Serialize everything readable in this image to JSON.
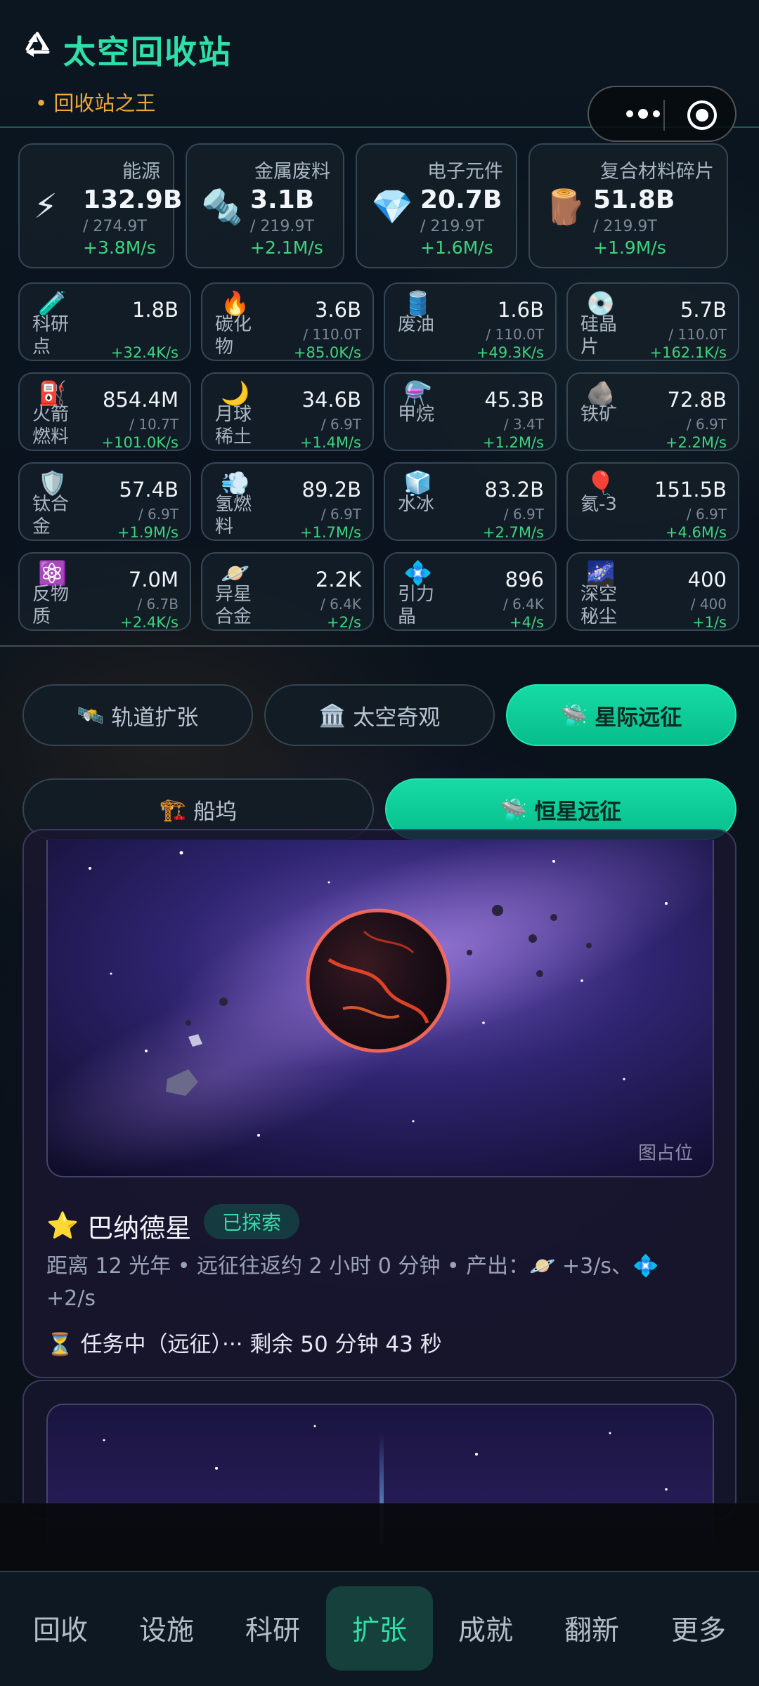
{
  "header": {
    "title": "太空回收站",
    "subtitle": "• 回收站之王",
    "logo_icon": "recycle-icon",
    "menu_icon": "more-dots-icon",
    "target_icon": "record-target-icon"
  },
  "primary_resources": [
    {
      "icon": "⚡",
      "name": "能源",
      "value": "132.9B",
      "capacity": "/ 274.9T",
      "rate": "+3.8M/s"
    },
    {
      "icon": "🔩",
      "name": "金属废料",
      "value": "3.1B",
      "capacity": "/ 219.9T",
      "rate": "+2.1M/s"
    },
    {
      "icon": "💎",
      "name": "电子元件",
      "value": "20.7B",
      "capacity": "/ 219.9T",
      "rate": "+1.6M/s"
    },
    {
      "icon": "🪵",
      "name": "复合材料碎片",
      "value": "51.8B",
      "capacity": "/ 219.9T",
      "rate": "+1.9M/s"
    }
  ],
  "secondary_resources": [
    {
      "icon": "🧪",
      "name": "科研点",
      "value": "1.8B",
      "capacity": "",
      "rate": "+32.4K/s"
    },
    {
      "icon": "🔥",
      "name": "碳化物",
      "value": "3.6B",
      "capacity": "/ 110.0T",
      "rate": "+85.0K/s"
    },
    {
      "icon": "🛢️",
      "name": "废油",
      "value": "1.6B",
      "capacity": "/ 110.0T",
      "rate": "+49.3K/s"
    },
    {
      "icon": "💿",
      "name": "硅晶片",
      "value": "5.7B",
      "capacity": "/ 110.0T",
      "rate": "+162.1K/s"
    },
    {
      "icon": "⛽",
      "name": "火箭燃料",
      "value": "854.4M",
      "capacity": "/ 10.7T",
      "rate": "+101.0K/s"
    },
    {
      "icon": "🌙",
      "name": "月球稀土",
      "value": "34.6B",
      "capacity": "/ 6.9T",
      "rate": "+1.4M/s"
    },
    {
      "icon": "⚗️",
      "name": "甲烷",
      "value": "45.3B",
      "capacity": "/ 3.4T",
      "rate": "+1.2M/s"
    },
    {
      "icon": "🪨",
      "name": "铁矿",
      "value": "72.8B",
      "capacity": "/ 6.9T",
      "rate": "+2.2M/s"
    },
    {
      "icon": "🛡️",
      "name": "钛合金",
      "value": "57.4B",
      "capacity": "/ 6.9T",
      "rate": "+1.9M/s"
    },
    {
      "icon": "💨",
      "name": "氢燃料",
      "value": "89.2B",
      "capacity": "/ 6.9T",
      "rate": "+1.7M/s"
    },
    {
      "icon": "🧊",
      "name": "水冰",
      "value": "83.2B",
      "capacity": "/ 6.9T",
      "rate": "+2.7M/s"
    },
    {
      "icon": "🎈",
      "name": "氦-3",
      "value": "151.5B",
      "capacity": "/ 6.9T",
      "rate": "+4.6M/s"
    },
    {
      "icon": "⚛️",
      "name": "反物质",
      "value": "7.0M",
      "capacity": "/ 6.7B",
      "rate": "+2.4K/s"
    },
    {
      "icon": "🪐",
      "name": "异星合金",
      "value": "2.2K",
      "capacity": "/ 6.4K",
      "rate": "+2/s"
    },
    {
      "icon": "💠",
      "name": "引力晶",
      "value": "896",
      "capacity": "/ 6.4K",
      "rate": "+4/s"
    },
    {
      "icon": "🌌",
      "name": "深空秘尘",
      "value": "400",
      "capacity": "/ 400",
      "rate": "+1/s"
    }
  ],
  "main_tabs": [
    {
      "icon": "🛰️",
      "label": "轨道扩张",
      "active": false
    },
    {
      "icon": "🏛️",
      "label": "太空奇观",
      "active": false
    },
    {
      "icon": "🛸",
      "label": "星际远征",
      "active": true
    }
  ],
  "sub_tabs": [
    {
      "icon": "🏗️",
      "label": "船坞",
      "active": false
    },
    {
      "icon": "🛸",
      "label": "恒星远征",
      "active": true
    }
  ],
  "expedition": {
    "star_icon": "⭐",
    "title": "巴纳德星",
    "badge": "已探索",
    "info_line": "距离 12 光年 • 远征往返约 2 小时 0 分钟 • 产出：🪐 +3/s、💠 +2/s",
    "status_icon": "⏳",
    "status": "任务中（远征）··· 剩余 50 分钟 43 秒",
    "image_placeholder": "图占位"
  },
  "bottom_nav": [
    {
      "label": "回收",
      "active": false
    },
    {
      "label": "设施",
      "active": false
    },
    {
      "label": "科研",
      "active": false
    },
    {
      "label": "扩张",
      "active": true
    },
    {
      "label": "成就",
      "active": false
    },
    {
      "label": "翻新",
      "active": false
    },
    {
      "label": "更多",
      "active": false
    }
  ],
  "colors": {
    "accent": "#2ee0a8",
    "gold": "#f0a83a",
    "rate_green": "#3ed47e"
  }
}
